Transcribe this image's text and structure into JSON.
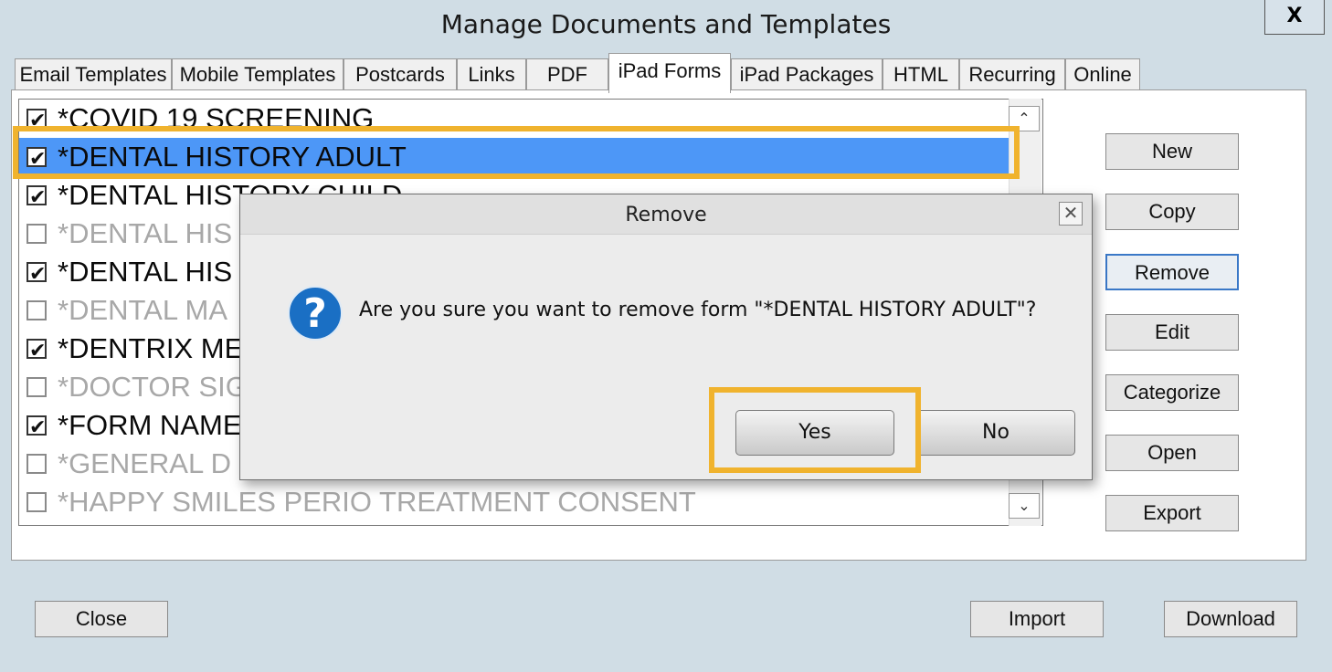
{
  "window": {
    "title": "Manage Documents and Templates",
    "close_label": "X"
  },
  "tabs": [
    {
      "label": "Email Templates",
      "active": false
    },
    {
      "label": "Mobile Templates",
      "active": false
    },
    {
      "label": "Postcards",
      "active": false
    },
    {
      "label": "Links",
      "active": false
    },
    {
      "label": "PDF",
      "active": false
    },
    {
      "label": "iPad Forms",
      "active": true
    },
    {
      "label": "iPad Packages",
      "active": false
    },
    {
      "label": "HTML",
      "active": false
    },
    {
      "label": "Recurring",
      "active": false
    },
    {
      "label": "Online",
      "active": false
    }
  ],
  "forms": [
    {
      "label": "*COVID 19 SCREENING",
      "checked": true,
      "enabled": true,
      "selected": false
    },
    {
      "label": "*DENTAL HISTORY ADULT",
      "checked": true,
      "enabled": true,
      "selected": true
    },
    {
      "label": "*DENTAL HISTORY CHILD",
      "checked": true,
      "enabled": true,
      "selected": false
    },
    {
      "label": "*DENTAL HIS",
      "checked": false,
      "enabled": false,
      "selected": false
    },
    {
      "label": "*DENTAL HIS",
      "checked": true,
      "enabled": true,
      "selected": false
    },
    {
      "label": "*DENTAL MA",
      "checked": false,
      "enabled": false,
      "selected": false
    },
    {
      "label": "*DENTRIX ME",
      "checked": true,
      "enabled": true,
      "selected": false
    },
    {
      "label": "*DOCTOR SIG",
      "checked": false,
      "enabled": false,
      "selected": false
    },
    {
      "label": "*FORM NAME",
      "checked": true,
      "enabled": true,
      "selected": false
    },
    {
      "label": "*GENERAL D",
      "checked": false,
      "enabled": false,
      "selected": false
    },
    {
      "label": "*HAPPY SMILES PERIO TREATMENT CONSENT",
      "checked": false,
      "enabled": false,
      "selected": false
    }
  ],
  "scroll": {
    "up_glyph": "⌃",
    "down_glyph": "⌄"
  },
  "side_buttons": {
    "new": "New",
    "copy": "Copy",
    "remove": "Remove",
    "edit": "Edit",
    "categorize": "Categorize",
    "open": "Open",
    "export": "Export"
  },
  "bottom_buttons": {
    "close": "Close",
    "import": "Import",
    "download": "Download"
  },
  "dialog": {
    "title": "Remove",
    "close_glyph": "✕",
    "icon": "question-icon",
    "icon_glyph": "?",
    "message": "Are you sure you want to remove form \"*DENTAL HISTORY ADULT\"?",
    "yes": "Yes",
    "no": "No"
  },
  "colors": {
    "selection": "#4d97f7",
    "highlight": "#f0b32e",
    "question_icon": "#1a6fc4"
  }
}
